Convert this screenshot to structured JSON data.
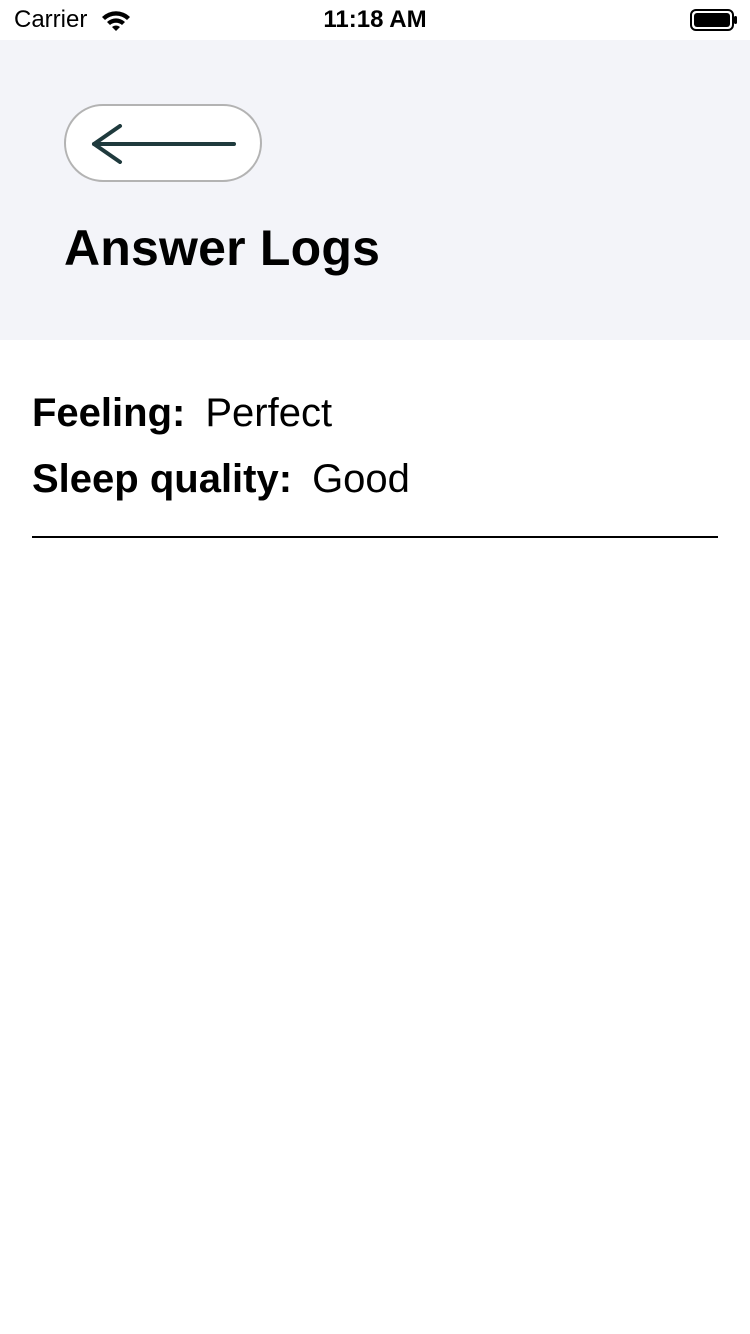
{
  "status_bar": {
    "carrier": "Carrier",
    "time": "11:18 AM",
    "wifi_icon": "wifi-icon",
    "battery_icon": "battery-full-icon"
  },
  "header": {
    "back_icon": "arrow-left-icon",
    "title": "Answer Logs",
    "background_color": "#f3f4f9"
  },
  "log_entry": {
    "rows": [
      {
        "label": "Feeling:",
        "value": "Perfect"
      },
      {
        "label": "Sleep quality:",
        "value": "Good"
      }
    ]
  }
}
